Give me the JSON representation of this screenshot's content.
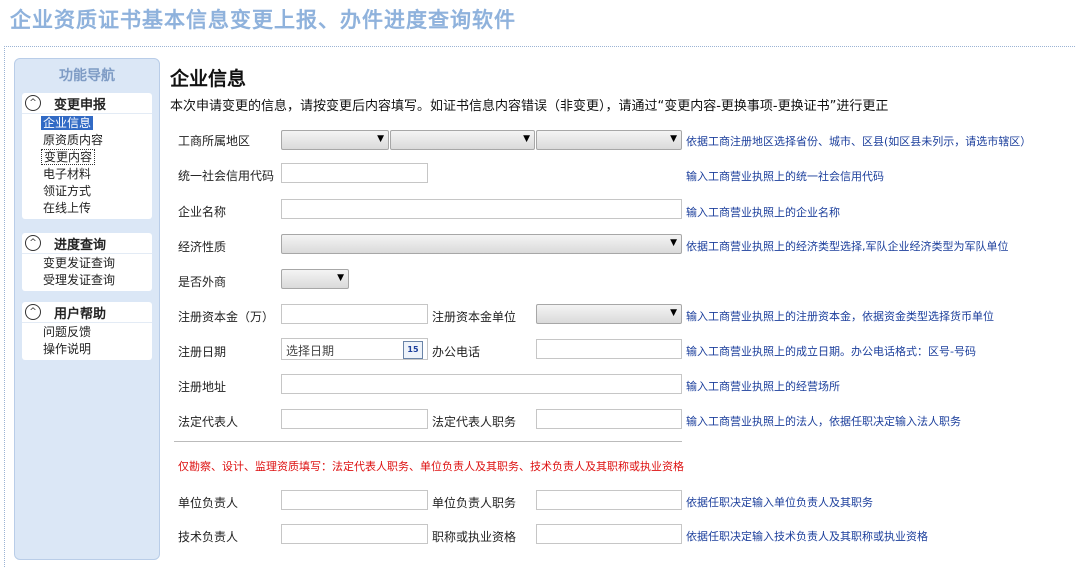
{
  "app_title": "企业资质证书基本信息变更上报、办件进度查询软件",
  "sidebar": {
    "title": "功能导航",
    "groups": [
      {
        "label": "变更申报",
        "items": [
          "企业信息",
          "原资质内容",
          "变更内容",
          "电子材料",
          "领证方式",
          "在线上传"
        ]
      },
      {
        "label": "进度查询",
        "items": [
          "变更发证查询",
          "受理发证查询"
        ]
      },
      {
        "label": "用户帮助",
        "items": [
          "问题反馈",
          "操作说明"
        ]
      }
    ],
    "chevron_glyph": "^"
  },
  "main": {
    "title": "企业信息",
    "description": "本次申请变更的信息，请按变更后内容填写。如证书信息内容错误（非变更），请通过“变更内容-更换事项-更换证书”进行更正"
  },
  "form": {
    "region_label": "工商所属地区",
    "region_hint": "依据工商注册地区选择省份、城市、区县(如区县未列示，请选市辖区）",
    "credit_code_label": "统一社会信用代码",
    "credit_code_hint": "输入工商营业执照上的统一社会信用代码",
    "company_name_label": "企业名称",
    "company_name_hint": "输入工商营业执照上的企业名称",
    "economic_type_label": "经济性质",
    "economic_type_hint": "依据工商营业执照上的经济类型选择,军队企业经济类型为军队单位",
    "foreign_label": "是否外商",
    "capital_label": "注册资本金（万）",
    "capital_unit_label": "注册资本金单位",
    "capital_hint": "输入工商营业执照上的注册资本金，依据资金类型选择货币单位",
    "reg_date_label": "注册日期",
    "reg_date_placeholder": "选择日期",
    "calendar_glyph": "15",
    "phone_label": "办公电话",
    "reg_date_hint": "输入工商营业执照上的成立日期。办公电话格式：区号-号码",
    "address_label": "注册地址",
    "address_hint": "输入工商营业执照上的经营场所",
    "legal_rep_label": "法定代表人",
    "legal_rep_title_label": "法定代表人职务",
    "legal_rep_hint": "输入工商营业执照上的法人，依据任职决定输入法人职务",
    "red_notice": "仅勘察、设计、监理资质填写：法定代表人职务、单位负责人及其职务、技术负责人及其职称或执业资格",
    "unit_head_label": "单位负责人",
    "unit_head_title_label": "单位负责人职务",
    "unit_head_hint": "依据任职决定输入单位负责人及其职务",
    "tech_head_label": "技术负责人",
    "tech_title_label": "职称或执业资格",
    "tech_head_hint": "依据任职决定输入技术负责人及其职称或执业资格",
    "dropdown_glyph": "▼"
  }
}
